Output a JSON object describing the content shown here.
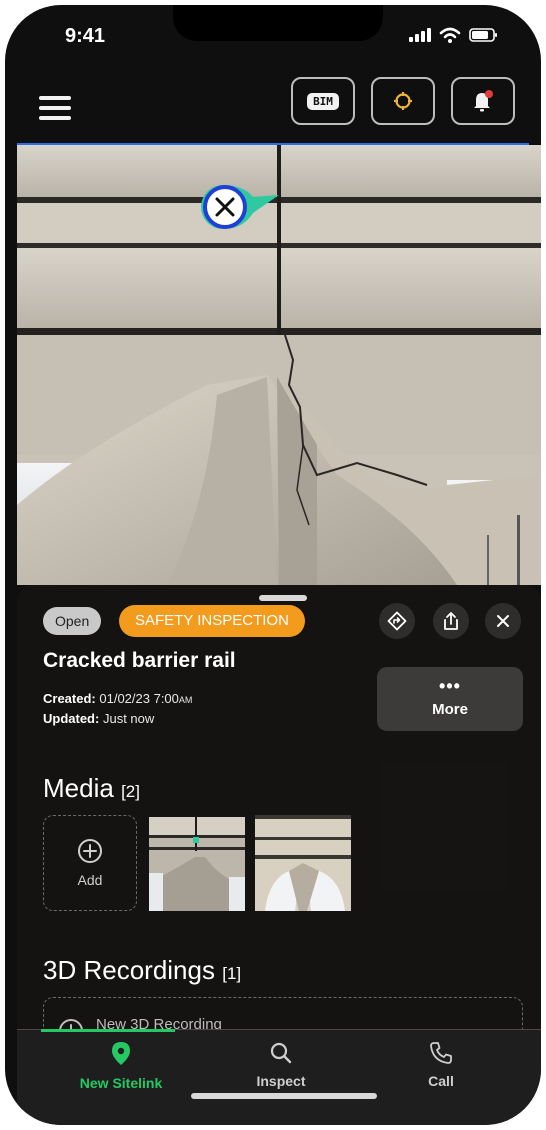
{
  "status_bar": {
    "time": "9:41"
  },
  "top_bar": {
    "bim_label": "BIM"
  },
  "ticket": {
    "status_chip": "Open",
    "category_chip": "SAFETY INSPECTION",
    "title": "Cracked barrier rail",
    "created_label": "Created:",
    "created_value": "01/02/23 7:00",
    "created_ampm": "AM",
    "updated_label": "Updated:",
    "updated_value": "Just now",
    "more_label": "More"
  },
  "media": {
    "title": "Media",
    "count": "[2]",
    "add_label": "Add"
  },
  "recordings": {
    "title": "3D Recordings",
    "count": "[1]",
    "new_label": "New 3D Recording"
  },
  "tabs": [
    {
      "label": "New Sitelink",
      "icon": "map-pin-icon",
      "active": true
    },
    {
      "label": "Inspect",
      "icon": "search-icon",
      "active": false
    },
    {
      "label": "Call",
      "icon": "phone-icon",
      "active": false
    }
  ],
  "colors": {
    "accent_green": "#25c964",
    "safety_orange": "#f39b1d",
    "marker_blue": "#1f3fd6",
    "marker_teal": "#2ec9a0"
  }
}
